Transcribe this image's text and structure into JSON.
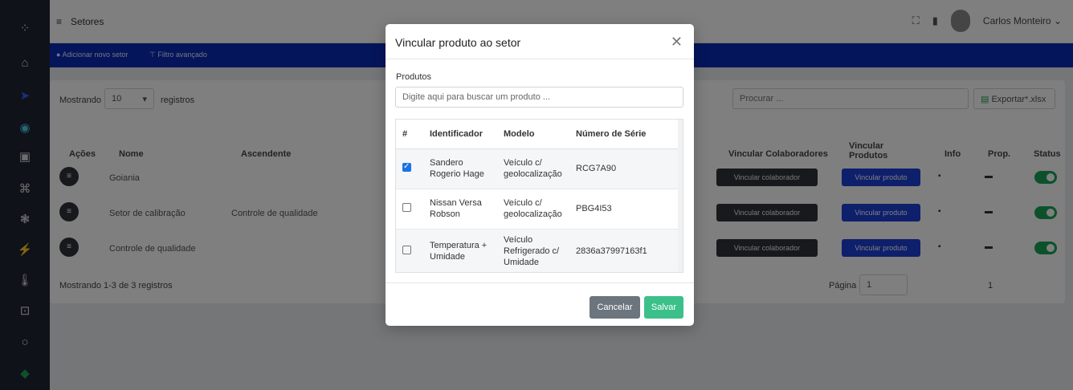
{
  "topbar": {
    "title": "Setores",
    "user_name": "Carlos Monteiro ⌄"
  },
  "actions": {
    "add_sector": "Adicionar novo setor",
    "advanced_filter": "Filtro avançado"
  },
  "list": {
    "showing_label": "Mostrando",
    "page_size": "10",
    "records_label": "registros",
    "search_placeholder": "Procurar ...",
    "export_label": "Exportar*.xlsx",
    "columns": [
      "Ações",
      "Nome",
      "Ascendente",
      "Vincular Colaboradores",
      "Vincular Produtos",
      "Info",
      "Prop.",
      "Status"
    ],
    "rows": [
      {
        "name": "Goiania",
        "parent": ""
      },
      {
        "name": "Setor de calibração",
        "parent": "Controle de qualidade"
      },
      {
        "name": "Controle de qualidade",
        "parent": ""
      }
    ],
    "link_collaborator_label": "Vincular colaborador",
    "link_product_label": "Vincular produto",
    "footer": "Mostrando 1-3 de 3 registros",
    "page_label": "Página",
    "page_value": "1",
    "page_number": "1"
  },
  "modal": {
    "title": "Vincular produto ao setor",
    "products_label": "Produtos",
    "search_placeholder": "Digite aqui para buscar um produto ...",
    "columns": [
      "#",
      "Identificador",
      "Modelo",
      "Número de Série"
    ],
    "rows": [
      {
        "checked": true,
        "identifier": "Sandero Rogerio Hage",
        "model": "Veículo c/ geolocalização",
        "serial": "RCG7A90"
      },
      {
        "checked": false,
        "identifier": "Nissan Versa Robson",
        "model": "Veículo c/ geolocalização",
        "serial": "PBG4I53"
      },
      {
        "checked": false,
        "identifier": "Temperatura + Umidade",
        "model": "Veículo Refrigerado c/ Umidade",
        "serial": "2836a37997163f1"
      }
    ],
    "cancel_label": "Cancelar",
    "save_label": "Salvar"
  },
  "colors": {
    "sidebar": "#1f2530",
    "action_bar": "#0a2bb8",
    "save_button": "#3cc08a",
    "cancel_button": "#6c757d",
    "status_toggle": "#1aa357",
    "link_product_button": "#1c3fd8"
  }
}
